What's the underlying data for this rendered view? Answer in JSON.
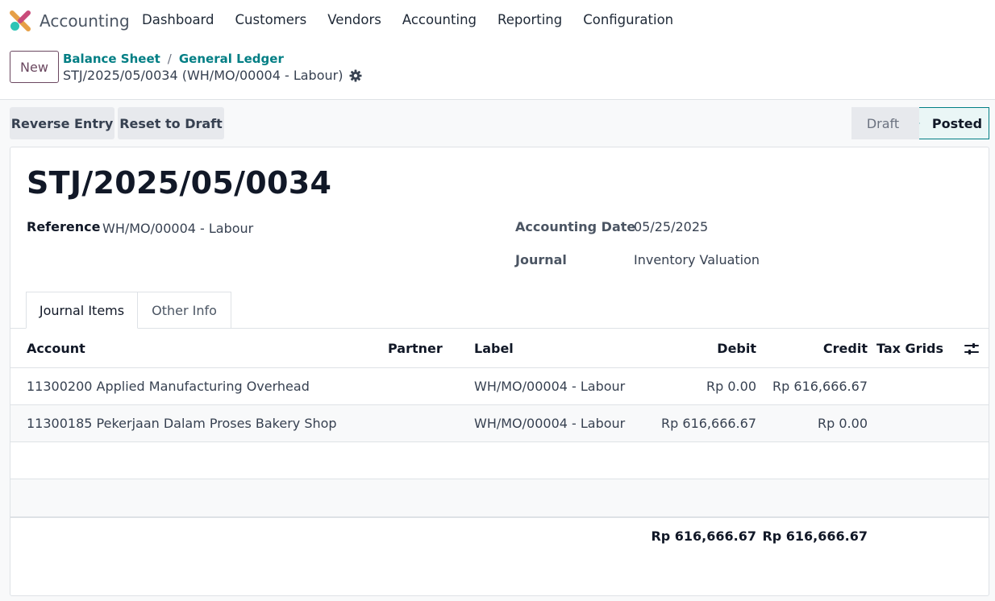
{
  "app": {
    "name": "Accounting",
    "menu": [
      "Dashboard",
      "Customers",
      "Vendors",
      "Accounting",
      "Reporting",
      "Configuration"
    ]
  },
  "control": {
    "new_label": "New",
    "breadcrumbs": [
      "Balance Sheet",
      "General Ledger"
    ],
    "breadcrumb_sep": "/",
    "record_name": "STJ/2025/05/0034 (WH/MO/00004 - Labour)"
  },
  "actions": {
    "reverse_entry": "Reverse Entry",
    "reset_to_draft": "Reset to Draft"
  },
  "status": {
    "steps": [
      "Draft",
      "Posted"
    ],
    "current": "Posted"
  },
  "form": {
    "title": "STJ/2025/05/0034",
    "reference_label": "Reference",
    "reference_value": "WH/MO/00004 - Labour",
    "date_label": "Accounting Date",
    "date_value": "05/25/2025",
    "journal_label": "Journal",
    "journal_value": "Inventory Valuation"
  },
  "tabs": [
    "Journal Items",
    "Other Info"
  ],
  "table": {
    "columns": {
      "account": "Account",
      "partner": "Partner",
      "label": "Label",
      "debit": "Debit",
      "credit": "Credit",
      "tax_grids": "Tax Grids"
    },
    "rows": [
      {
        "account": "11300200 Applied Manufacturing Overhead",
        "partner": "",
        "label": "WH/MO/00004 - Labour",
        "debit": "Rp 0.00",
        "credit": "Rp 616,666.67",
        "tax_grids": ""
      },
      {
        "account": "11300185 Pekerjaan Dalam Proses Bakery Shop",
        "partner": "",
        "label": "WH/MO/00004 - Labour",
        "debit": "Rp 616,666.67",
        "credit": "Rp 0.00",
        "tax_grids": ""
      }
    ],
    "totals": {
      "debit": "Rp 616,666.67",
      "credit": "Rp 616,666.67"
    }
  },
  "colors": {
    "brand_link": "#017e84",
    "new_button": "#6b4860",
    "status_active_border": "#017e84"
  }
}
